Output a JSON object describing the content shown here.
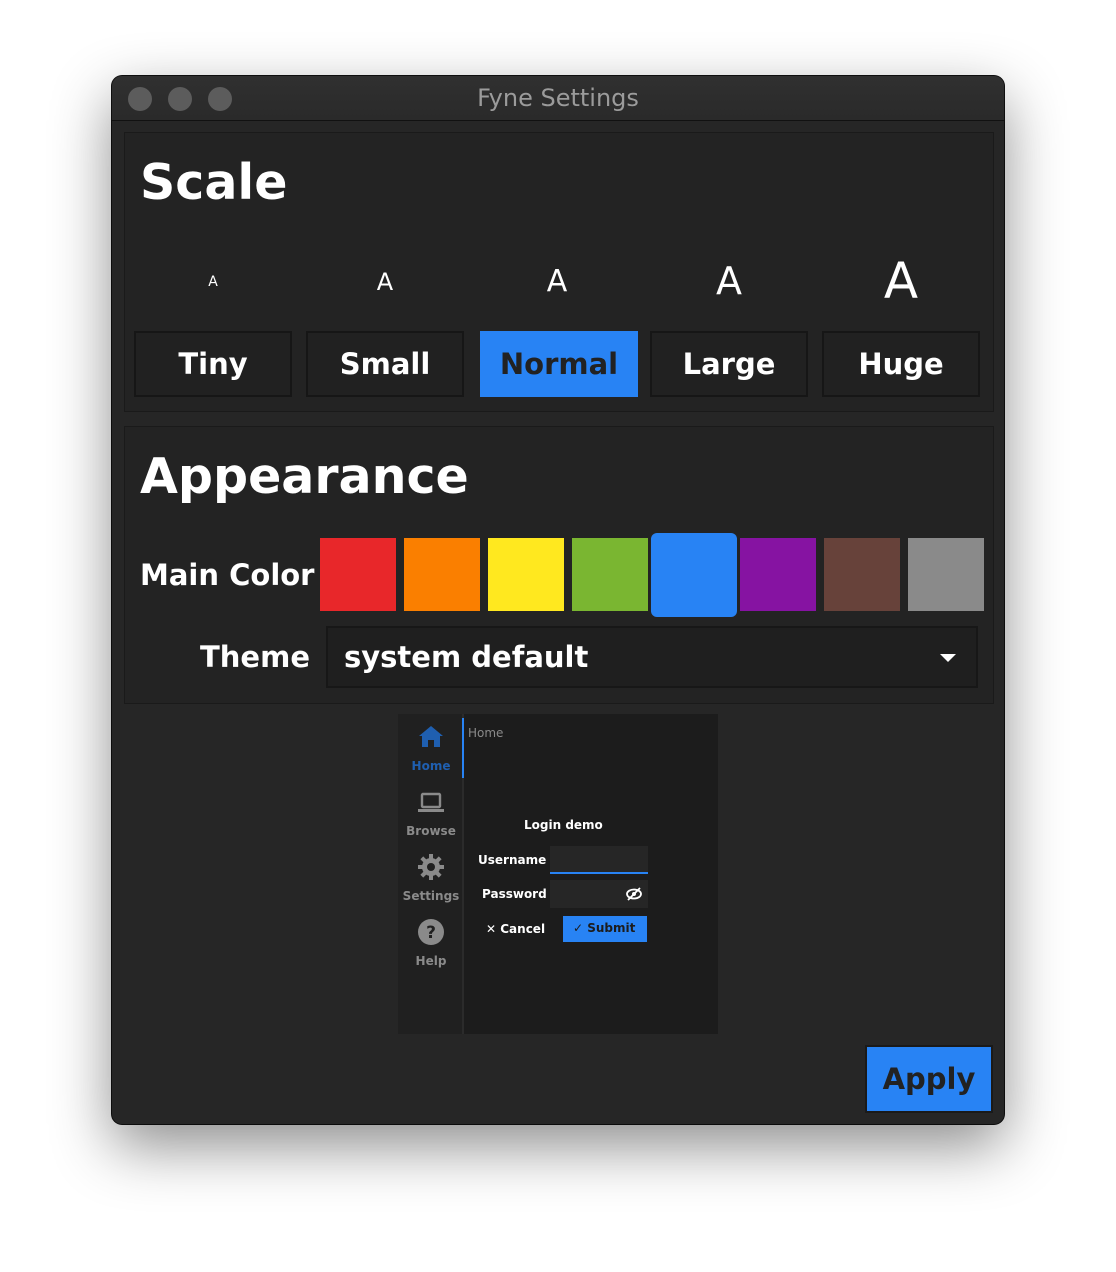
{
  "window": {
    "title": "Fyne Settings"
  },
  "scale": {
    "heading": "Scale",
    "preview_glyph": "A",
    "options": [
      {
        "label": "Tiny",
        "selected": false
      },
      {
        "label": "Small",
        "selected": false
      },
      {
        "label": "Normal",
        "selected": true
      },
      {
        "label": "Large",
        "selected": false
      },
      {
        "label": "Huge",
        "selected": false
      }
    ]
  },
  "appearance": {
    "heading": "Appearance",
    "main_color_label": "Main Color",
    "colors": [
      {
        "name": "red",
        "hex": "#e8272a"
      },
      {
        "name": "orange",
        "hex": "#fa7f00"
      },
      {
        "name": "yellow",
        "hex": "#ffe81f"
      },
      {
        "name": "green",
        "hex": "#7ab631"
      },
      {
        "name": "blue",
        "hex": "#2883f4",
        "selected": true
      },
      {
        "name": "purple",
        "hex": "#8613a2"
      },
      {
        "name": "brown",
        "hex": "#67423a"
      },
      {
        "name": "gray",
        "hex": "#8a8a8a"
      }
    ],
    "theme_label": "Theme",
    "theme_value": "system default"
  },
  "preview": {
    "nav": [
      {
        "label": "Home",
        "icon": "home-icon",
        "active": true
      },
      {
        "label": "Browse",
        "icon": "laptop-icon",
        "active": false
      },
      {
        "label": "Settings",
        "icon": "gear-icon",
        "active": false
      },
      {
        "label": "Help",
        "icon": "help-icon",
        "active": false
      }
    ],
    "breadcrumb": "Home",
    "form_title": "Login demo",
    "username_label": "Username",
    "password_label": "Password",
    "cancel_label": "Cancel",
    "submit_label": "Submit"
  },
  "actions": {
    "apply_label": "Apply"
  },
  "colors": {
    "accent": "#2883f4",
    "background": "#262626"
  }
}
